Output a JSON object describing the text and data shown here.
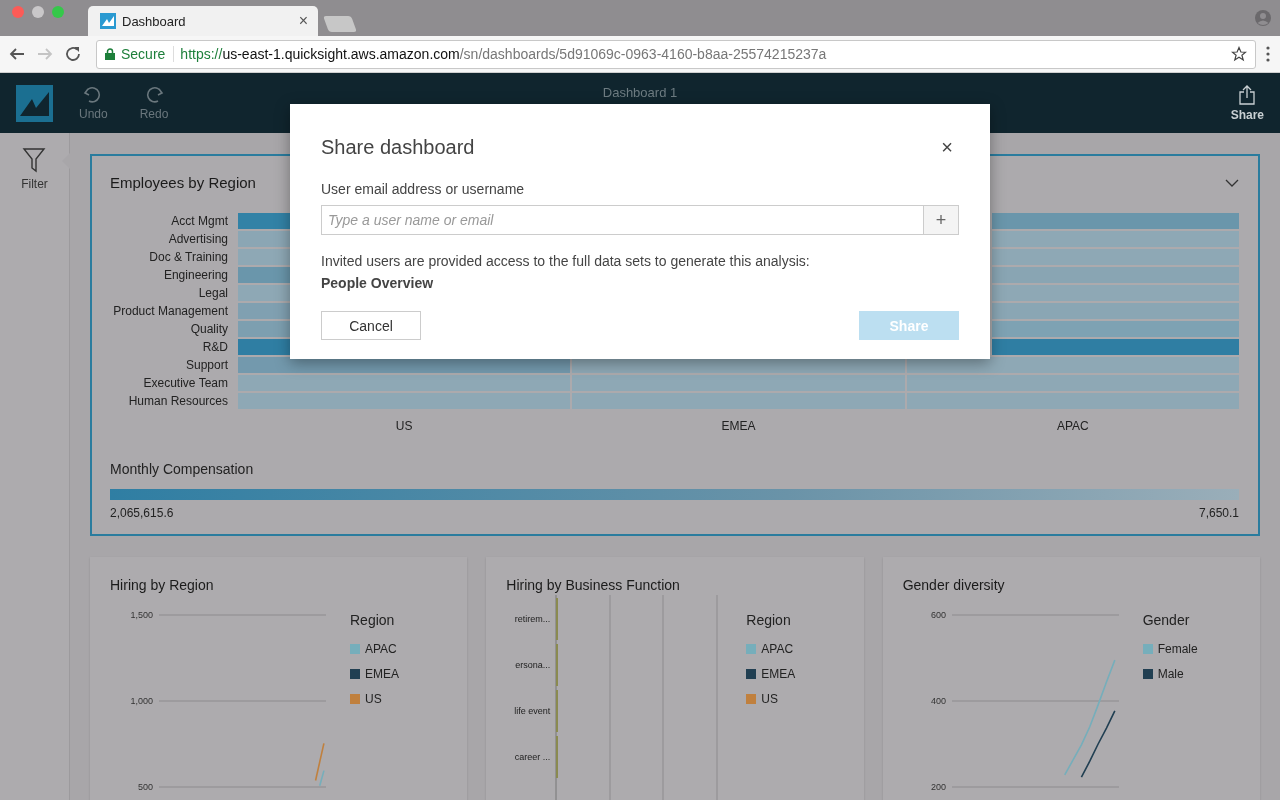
{
  "browser": {
    "tab_title": "Dashboard",
    "tab_close_label": "×",
    "security_label": "Secure",
    "url": {
      "scheme": "https://",
      "host": "us-east-1.quicksight.aws.amazon.com",
      "path": "/sn/dashboards/5d91069c-0963-4160-b8aa-25574215237a"
    },
    "forward_disabled": true
  },
  "toolbar": {
    "actions": [
      {
        "kind": "undo",
        "label": "Undo"
      },
      {
        "kind": "redo",
        "label": "Redo"
      }
    ],
    "title": "Dashboard 1",
    "share_label": "Share"
  },
  "sidebar": {
    "items": [
      {
        "kind": "filter",
        "label": "Filter"
      }
    ]
  },
  "heatmap_card": {
    "title": "Employees by Region",
    "columns": [
      "US",
      "EMEA",
      "APAC"
    ],
    "rows": [
      {
        "label": "Acct Mgmt",
        "cells": [
          {
            "color": "#3282a6"
          },
          {},
          {
            "color": "#6a96ab"
          }
        ]
      },
      {
        "label": "Advertising",
        "cells": [
          {
            "color": "#8ba6b4"
          },
          {},
          {
            "color": "#8ea8b5"
          }
        ]
      },
      {
        "label": "Doc & Training",
        "cells": [
          {
            "color": "#8ea8b5"
          },
          {},
          {
            "color": "#8ea8b5"
          }
        ]
      },
      {
        "label": "Engineering",
        "cells": [
          {
            "color": "#6a96ab"
          },
          {},
          {
            "color": "#89a5b3"
          }
        ]
      },
      {
        "label": "Legal",
        "cells": [
          {
            "color": "#8ea8b5"
          },
          {},
          {
            "color": "#8ea8b5"
          }
        ]
      },
      {
        "label": "Product Management",
        "cells": [
          {
            "color": "#80a0b1"
          },
          {},
          {
            "color": "#8aa6b4"
          }
        ]
      },
      {
        "label": "Quality",
        "cells": [
          {
            "color": "#7d9fb0"
          },
          {},
          {
            "color": "#7ea2b3"
          }
        ]
      },
      {
        "label": "R&D",
        "cells": [
          {
            "color": "#2f7ea3"
          },
          {},
          {
            "color": "#2f7ea3"
          }
        ]
      },
      {
        "label": "Support",
        "cells": [
          {
            "color": "#7399ad"
          },
          {
            "color": "#8ea8b5"
          },
          {
            "color": "#8ea8b5"
          }
        ]
      },
      {
        "label": "Executive Team",
        "cells": [
          {
            "color": "#8ea8b5"
          },
          {
            "color": "#8ea8b5"
          },
          {
            "color": "#8ea8b5"
          }
        ]
      },
      {
        "label": "Human Resources",
        "cells": [
          {
            "color": "#8ea8b5"
          },
          {
            "color": "#8ea8b5"
          },
          {
            "color": "#8ea8b5"
          }
        ]
      }
    ],
    "legend": {
      "title": "Monthly Compensation",
      "min": "2,065,615.6",
      "max": "7,650.1"
    }
  },
  "charts": [
    {
      "kind": "line",
      "title": "Hiring by Region",
      "legend_title": "Region",
      "legend": [
        {
          "label": "APAC",
          "color": "#76aebb"
        },
        {
          "label": "EMEA",
          "color": "#213f52"
        },
        {
          "label": "US",
          "color": "#c0803e"
        }
      ],
      "chart_data": {
        "type": "line",
        "grid": true,
        "ylim": [
          500,
          1500
        ],
        "yticks": [
          {
            "value": 500,
            "label": "500"
          },
          {
            "value": 1000,
            "label": "1,000"
          },
          {
            "value": 1500,
            "label": "1,500"
          }
        ],
        "series": [
          {
            "color": "#76aebb",
            "values": [
              null,
              null,
              null,
              null,
              null,
              null,
              null,
              null,
              null,
              null,
              null,
              null,
              null,
              null,
              null,
              null,
              null,
              null,
              null,
              null,
              null,
              null,
              null,
              null,
              null,
              null,
              null,
              null,
              null,
              null,
              null,
              null,
              null,
              null,
              null,
              null,
              null,
              null,
              507,
              595
            ]
          },
          {
            "color": "#c0803e",
            "values": [
              null,
              null,
              null,
              null,
              null,
              null,
              null,
              null,
              null,
              null,
              null,
              null,
              null,
              null,
              null,
              null,
              null,
              null,
              null,
              null,
              null,
              null,
              null,
              null,
              null,
              null,
              null,
              null,
              null,
              null,
              null,
              null,
              null,
              null,
              null,
              null,
              null,
              538,
              646,
              754
            ]
          }
        ]
      }
    },
    {
      "kind": "bar",
      "title": "Hiring by Business Function",
      "legend_title": "Region",
      "legend": [
        {
          "label": "APAC",
          "color": "#76aebb"
        },
        {
          "label": "EMEA",
          "color": "#213f52"
        },
        {
          "label": "US",
          "color": "#c0803e"
        }
      ],
      "categories": [
        "retirem...",
        "ersona...",
        "life event",
        "career ..."
      ]
    },
    {
      "kind": "line",
      "title": "Gender diversity",
      "legend_title": "Gender",
      "legend": [
        {
          "label": "Female",
          "color": "#76aebb"
        },
        {
          "label": "Male",
          "color": "#213f52"
        }
      ],
      "chart_data": {
        "type": "line",
        "grid": true,
        "ylim": [
          200,
          600
        ],
        "yticks": [
          {
            "value": 200,
            "label": "200"
          },
          {
            "value": 400,
            "label": "400"
          },
          {
            "value": 600,
            "label": "600"
          }
        ],
        "series": [
          {
            "color": "#76aebb",
            "values": [
              null,
              null,
              null,
              null,
              null,
              null,
              null,
              null,
              null,
              null,
              null,
              null,
              null,
              228,
              263,
              298,
              340,
              391,
              444,
              495
            ]
          },
          {
            "color": "#213f52",
            "values": [
              null,
              null,
              null,
              null,
              null,
              null,
              null,
              null,
              null,
              null,
              null,
              null,
              null,
              null,
              null,
              223,
              260,
              300,
              337,
              377
            ]
          }
        ]
      }
    }
  ],
  "dialog": {
    "title": "Share dashboard",
    "field_label": "User email address or username",
    "placeholder": "Type a user name or email",
    "add_label": "+",
    "note": "Invited users are provided access to the full data sets to generate this analysis:",
    "dataset": "People Overview",
    "cancel_label": "Cancel",
    "share": {
      "label": "Share",
      "disabled": true
    },
    "close_label": "×"
  }
}
